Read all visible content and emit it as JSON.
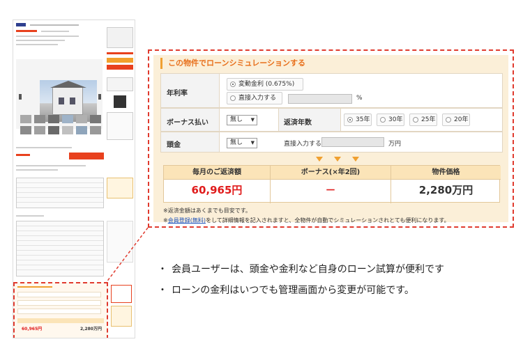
{
  "simulation": {
    "title": "この物件でローンシミュレーションする",
    "interest": {
      "label": "年利率",
      "option_variable": "変動金利 (0.675%)",
      "option_direct": "直接入力する",
      "unit": "%",
      "selected": "variable"
    },
    "bonus": {
      "label": "ボーナス払い",
      "select_value": "無し"
    },
    "term": {
      "label": "返済年数",
      "options": [
        "35年",
        "30年",
        "25年",
        "20年"
      ],
      "selected": "35年"
    },
    "down_payment": {
      "label": "頭金",
      "select_value": "無し",
      "direct_label": "直接入力する",
      "unit": "万円"
    },
    "results": {
      "monthly_header": "毎月のご返済額",
      "monthly_value": "60,965円",
      "bonus_header": "ボーナス(×年2回)",
      "bonus_value": "－",
      "price_header": "物件価格",
      "price_value": "2,280万円"
    },
    "note1": "※返済金額はあくまでも目安です。",
    "note2_prefix": "※",
    "note2_link1": "会員登録",
    "note2_link2": "(無料)",
    "note2_rest": "をして詳細情報を記入されますと、全物件が自動でシミュレーションされとても便利になります。",
    "colors": {
      "accent": "#e8701c",
      "price": "#e01b1b",
      "dashed": "#e03a2e",
      "panel_bg": "#fbefd8"
    }
  },
  "thumbnail": {
    "sim_price": "60,965円",
    "sim_total": "2,280万円"
  },
  "bullets": [
    "会員ユーザーは、頭金や金利など自身のローン試算が便利です",
    "ローンの金利はいつでも管理画面から変更が可能です。"
  ]
}
